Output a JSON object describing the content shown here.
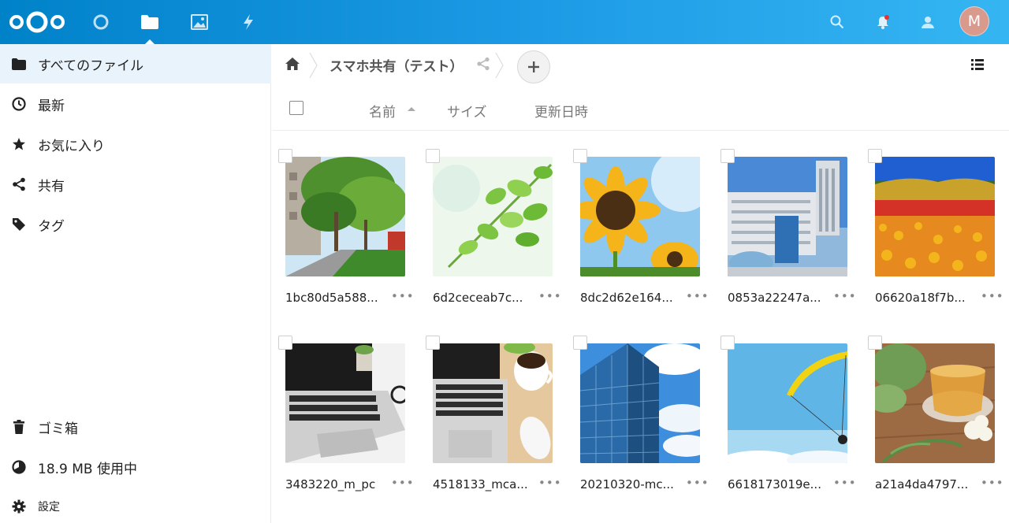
{
  "header": {
    "avatar_initial": "M",
    "colors": {
      "gradient_start": "#0082c9",
      "gradient_end": "#35b6f2",
      "avatar_bg": "#d99a8e"
    },
    "apps": [
      "dashboard-icon",
      "files-icon",
      "photos-icon",
      "activity-icon"
    ],
    "right_icons": [
      "search-icon",
      "notifications-icon",
      "contacts-icon"
    ]
  },
  "sidebar": {
    "items": [
      {
        "label": "すべてのファイル",
        "icon": "folder-icon"
      },
      {
        "label": "最新",
        "icon": "clock-icon"
      },
      {
        "label": "お気に入り",
        "icon": "star-icon"
      },
      {
        "label": "共有",
        "icon": "share-icon"
      },
      {
        "label": "タグ",
        "icon": "tag-icon"
      }
    ],
    "footer": [
      {
        "label": "ゴミ箱",
        "icon": "trash-icon"
      },
      {
        "label": "18.9 MB 使用中",
        "icon": "quota-pie-icon"
      },
      {
        "label": "設定",
        "icon": "gear-icon"
      }
    ]
  },
  "breadcrumb": {
    "folder": "スマホ共有（テスト）"
  },
  "columns": {
    "name": "名前",
    "size": "サイズ",
    "modified": "更新日時"
  },
  "files": [
    {
      "name": "1bc80d5a588...",
      "thumb": "street-trees"
    },
    {
      "name": "6d2ceceab7c...",
      "thumb": "green-leaves"
    },
    {
      "name": "8dc2d62e164...",
      "thumb": "sunflower"
    },
    {
      "name": "0853a22247a...",
      "thumb": "station-building"
    },
    {
      "name": "06620a18f7b...",
      "thumb": "flower-field"
    },
    {
      "name": "3483220_m_pc",
      "thumb": "laptop"
    },
    {
      "name": "4518133_mca...",
      "thumb": "laptop-coffee"
    },
    {
      "name": "20210320-mc...",
      "thumb": "office-tower"
    },
    {
      "name": "6618173019e...",
      "thumb": "paraglider"
    },
    {
      "name": "a21a4da4797...",
      "thumb": "tea-cup"
    }
  ],
  "more_label": "•••"
}
